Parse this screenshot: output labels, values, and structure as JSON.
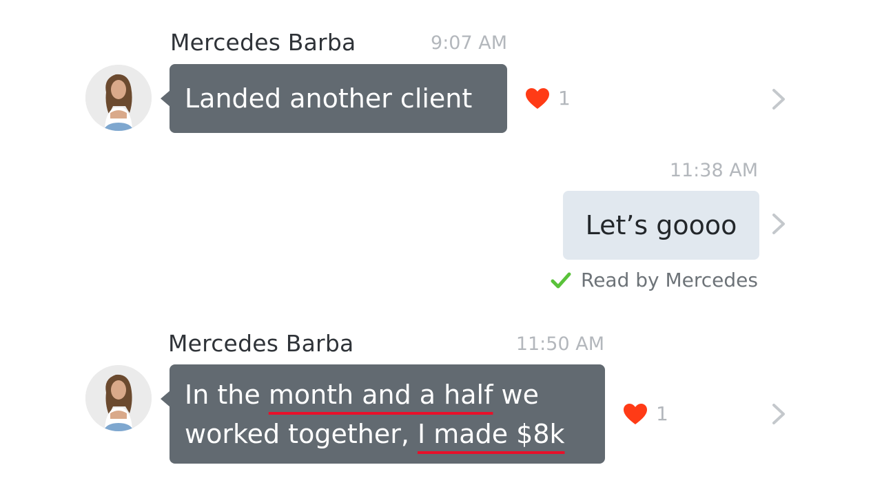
{
  "messages": [
    {
      "sender": "Mercedes Barba",
      "time": "9:07 AM",
      "text": "Landed another client",
      "reaction_count": "1",
      "reaction_icon": "heart-icon"
    },
    {
      "time": "11:38 AM",
      "text": "Let’s goooo",
      "read_receipt": "Read by Mercedes",
      "read_icon": "checkmark-icon"
    },
    {
      "sender": "Mercedes Barba",
      "time": "11:50 AM",
      "text_parts": {
        "p1": "In the ",
        "p2": "month and a half",
        "p3": " we",
        "p4": "worked together, ",
        "p5": "I made $8k"
      },
      "reaction_count": "1",
      "reaction_icon": "heart-icon"
    }
  ],
  "colors": {
    "incoming_bubble": "#626a71",
    "outgoing_bubble": "#e1e8ef",
    "heart": "#ff3b16",
    "check": "#59c23a",
    "underline": "#e8102a"
  }
}
